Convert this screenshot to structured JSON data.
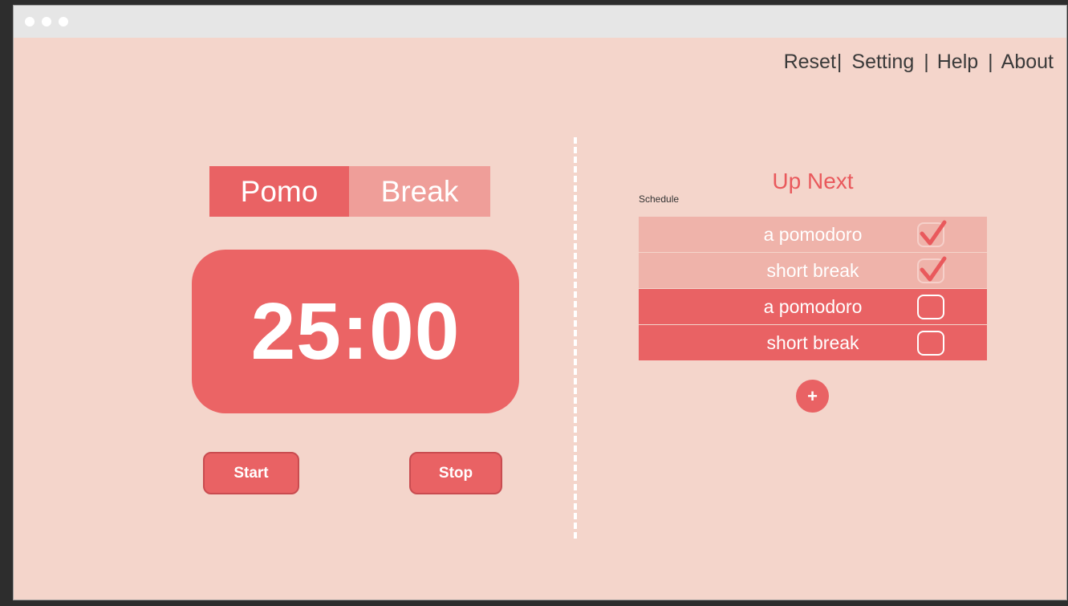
{
  "nav": {
    "items": [
      {
        "label": "Reset"
      },
      {
        "label": "Setting"
      },
      {
        "label": "Help"
      },
      {
        "label": "About"
      }
    ],
    "separator": "|"
  },
  "modes": {
    "pomo_label": "Pomo",
    "break_label": "Break",
    "active": "Pomo"
  },
  "timer": {
    "display": "25:00"
  },
  "controls": {
    "start_label": "Start",
    "stop_label": "Stop"
  },
  "upnext": {
    "title": "Up Next",
    "schedule_label": "Schedule",
    "items": [
      {
        "label": "a pomodoro",
        "checked": true
      },
      {
        "label": "short break",
        "checked": true
      },
      {
        "label": "a pomodoro",
        "checked": false
      },
      {
        "label": "short break",
        "checked": false
      }
    ],
    "add_label": "+"
  },
  "colors": {
    "background": "#f4d5cb",
    "accent": "#e96264",
    "accent_light": "#ef9e99",
    "done_row": "#efb3aa",
    "title_text": "#e9595c"
  },
  "icons": {
    "check": "checkmark-icon",
    "add": "plus-icon"
  }
}
